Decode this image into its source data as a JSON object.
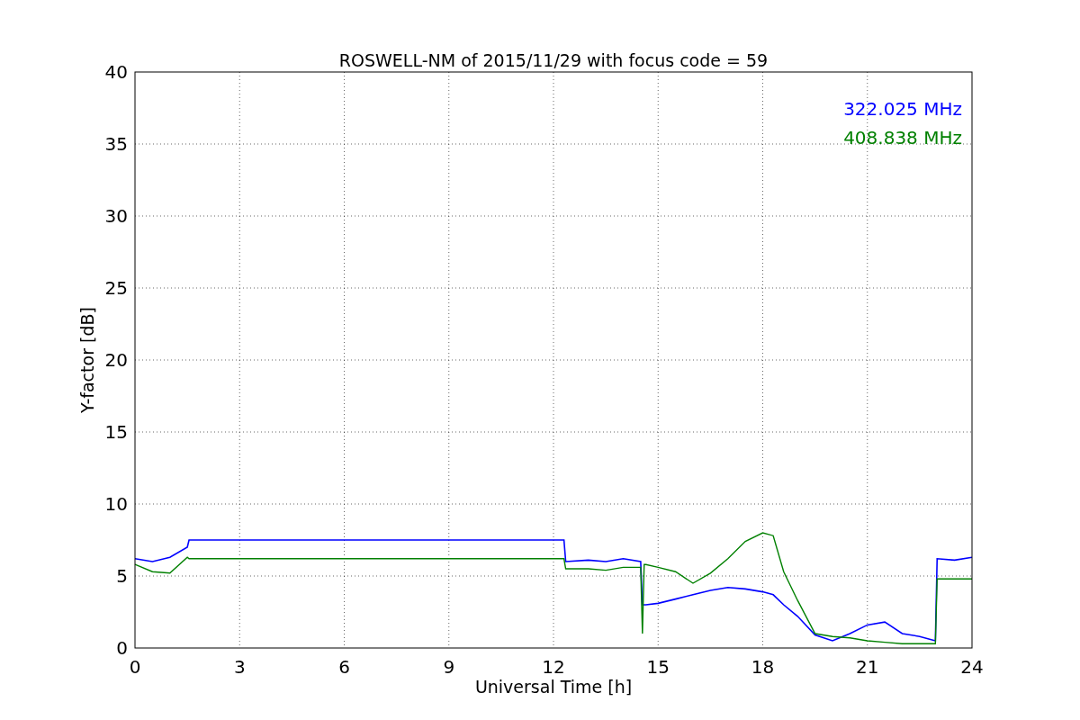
{
  "figure": {
    "chart_data": {
      "type": "line",
      "title": "ROSWELL-NM of 2015/11/29 with focus code = 59",
      "xlabel": "Universal Time [h]",
      "ylabel": "Y-factor [dB]",
      "x": [
        0,
        0.5,
        1,
        1.5,
        1.55,
        12.3,
        12.35,
        13,
        13.5,
        14,
        14.5,
        14.55,
        14.6,
        14.65,
        15,
        15.5,
        16,
        16.5,
        17,
        17.5,
        18,
        18.3,
        18.6,
        19,
        19.5,
        20,
        20.5,
        21,
        21.5,
        22,
        22.5,
        22.95,
        23,
        23.5,
        24
      ],
      "series": [
        {
          "name": "322.025 MHz",
          "color": "#0000ff",
          "values": [
            6.2,
            6.0,
            6.3,
            7.0,
            7.5,
            7.5,
            6.0,
            6.1,
            6.0,
            6.2,
            6.0,
            3.0,
            3.0,
            3.0,
            3.1,
            3.4,
            3.7,
            4.0,
            4.2,
            4.1,
            3.9,
            3.7,
            3.0,
            2.2,
            0.9,
            0.5,
            1.0,
            1.6,
            1.8,
            1.0,
            0.8,
            0.5,
            6.2,
            6.1,
            6.3
          ]
        },
        {
          "name": "408.838 MHz",
          "color": "#008000",
          "values": [
            5.8,
            5.3,
            5.2,
            6.3,
            6.2,
            6.2,
            5.5,
            5.5,
            5.4,
            5.6,
            5.6,
            1.0,
            5.8,
            5.8,
            5.6,
            5.3,
            4.5,
            5.2,
            6.2,
            7.4,
            8.0,
            7.8,
            5.3,
            3.3,
            1.0,
            0.8,
            0.7,
            0.5,
            0.4,
            0.3,
            0.3,
            0.3,
            4.8,
            4.8,
            4.8
          ]
        }
      ],
      "grid": true,
      "xlim": [
        0,
        24
      ],
      "ylim": [
        0,
        40
      ],
      "xticks": [
        0,
        3,
        6,
        9,
        12,
        15,
        18,
        21,
        24
      ],
      "yticks": [
        0,
        5,
        10,
        15,
        20,
        25,
        30,
        35,
        40
      ]
    }
  }
}
